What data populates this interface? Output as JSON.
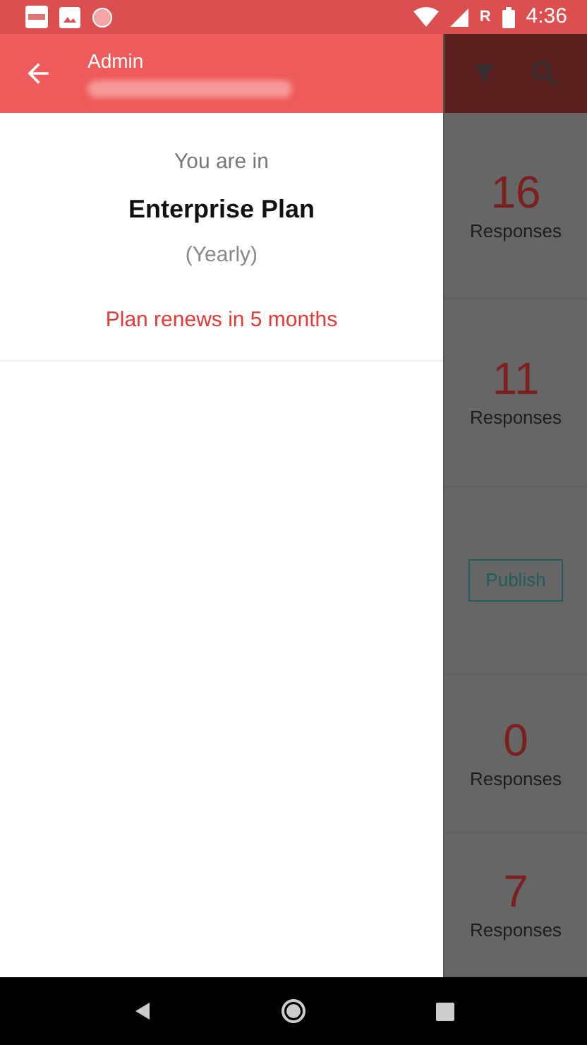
{
  "status_bar": {
    "network_label": "R",
    "time": "4:36"
  },
  "drawer": {
    "title": "Admin",
    "intro": "You are in",
    "plan": "Enterprise Plan",
    "billing": "(Yearly)",
    "renewal": "Plan renews in 5 months"
  },
  "background_list": [
    {
      "kind": "count",
      "count": "16",
      "label": "Responses"
    },
    {
      "kind": "count",
      "count": "11",
      "label": "Responses"
    },
    {
      "kind": "button",
      "label": "Publish"
    },
    {
      "kind": "count",
      "count": "0",
      "label": "Responses"
    },
    {
      "kind": "count",
      "count": "7",
      "label": "Responses"
    }
  ]
}
